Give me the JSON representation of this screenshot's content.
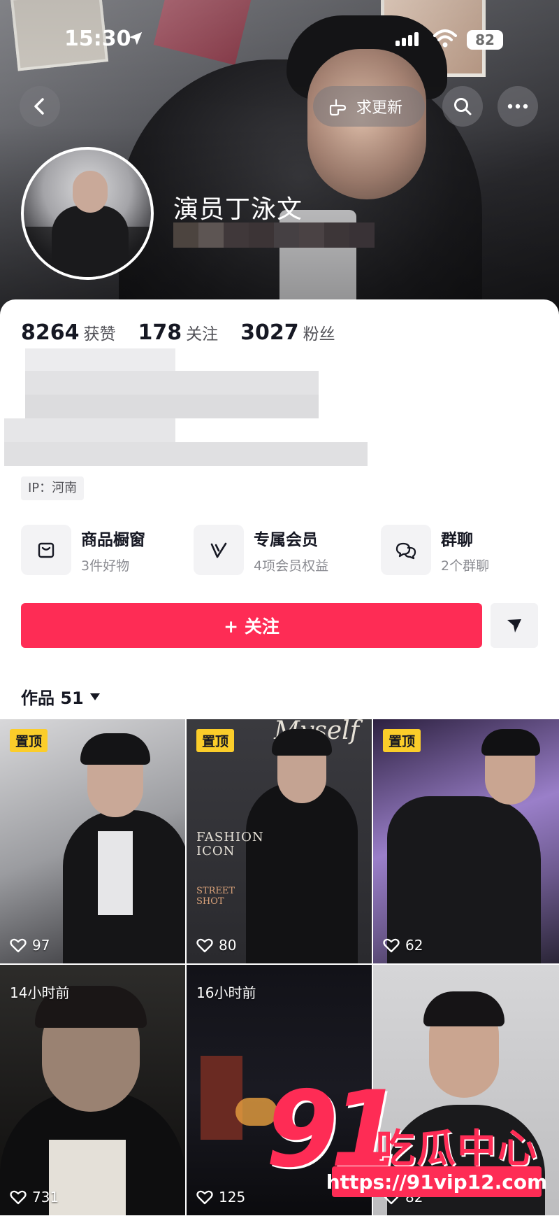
{
  "status": {
    "time": "15:30",
    "battery": "82"
  },
  "nav": {
    "request_update_label": "求更新"
  },
  "profile": {
    "name": "演员丁泳文"
  },
  "stats": [
    {
      "num": "8264",
      "label": "获赞"
    },
    {
      "num": "178",
      "label": "关注"
    },
    {
      "num": "3027",
      "label": "粉丝"
    }
  ],
  "ip": "IP：河南",
  "features": [
    {
      "title": "商品橱窗",
      "sub": "3件好物",
      "icon": "shopping-bag-icon"
    },
    {
      "title": "专属会员",
      "sub": "4项会员权益",
      "icon": "vip-v-icon"
    },
    {
      "title": "群聊",
      "sub": "2个群聊",
      "icon": "chat-bubbles-icon"
    }
  ],
  "follow_label": "+ 关注",
  "works_label": "作品 51",
  "pin_label": "置顶",
  "tiles": [
    {
      "tag": "置顶",
      "likes": "97"
    },
    {
      "tag": "置顶",
      "likes": "80",
      "text1": "FASHION",
      "text2": "ICON",
      "text3": "STREET",
      "text4": "SHOT",
      "text5": "Myself"
    },
    {
      "tag": "置顶",
      "likes": "62"
    },
    {
      "time": "14小时前",
      "likes": "731"
    },
    {
      "time": "16小时前",
      "likes": "125"
    },
    {
      "likes": "82"
    }
  ],
  "watermark": {
    "num": "91",
    "cn": "吃瓜中心",
    "url": "https://91vip12.com"
  },
  "colors": {
    "accent": "#fe2c55",
    "pin": "#fbcd2a"
  }
}
